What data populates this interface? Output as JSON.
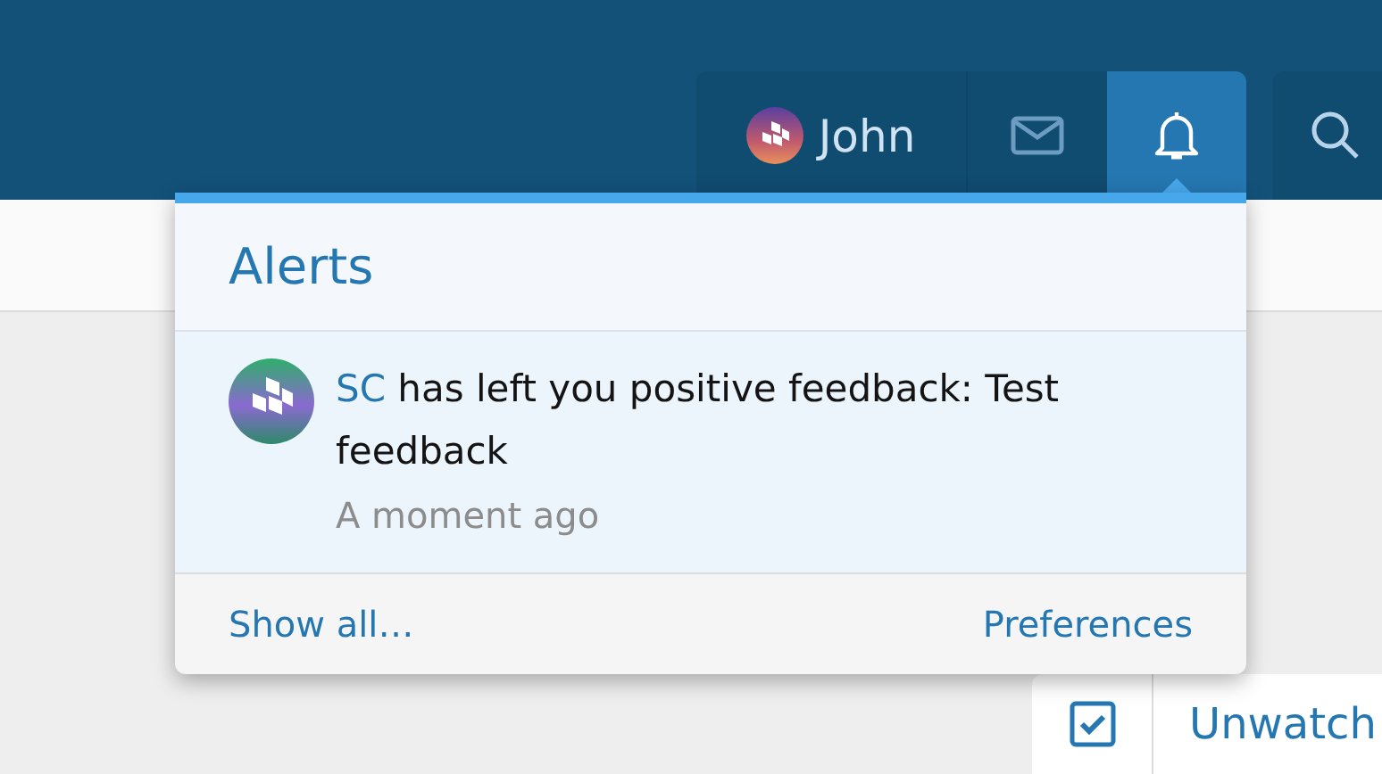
{
  "navigation": {
    "user": {
      "name": "John"
    },
    "tabs": [
      {
        "kind": "user",
        "selected": false
      },
      {
        "kind": "mail",
        "selected": false
      },
      {
        "kind": "alerts",
        "selected": true
      }
    ]
  },
  "alerts_menu": {
    "title": "Alerts",
    "items": [
      {
        "user": "SC",
        "text": "has left you positive feedback: Test feedback",
        "time": "A moment ago"
      }
    ],
    "footer": {
      "show_all": "Show all…",
      "preferences": "Preferences"
    }
  },
  "watch": {
    "checked": true,
    "label": "Unwatch"
  }
}
